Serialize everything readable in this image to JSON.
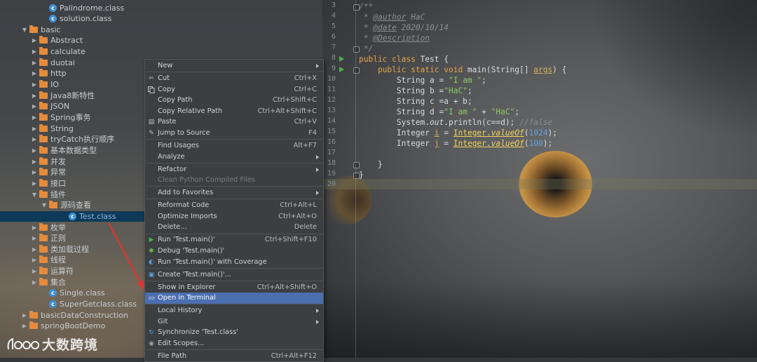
{
  "tree": [
    {
      "label": "Palindrome.class",
      "type": "class",
      "indent": 70,
      "arrow": ""
    },
    {
      "label": "solution.class",
      "type": "class",
      "indent": 70,
      "arrow": ""
    },
    {
      "label": "basic",
      "type": "folder",
      "indent": 56,
      "arrow": "open"
    },
    {
      "label": "Abstract",
      "type": "folder",
      "indent": 70,
      "arrow": "closed"
    },
    {
      "label": "calculate",
      "type": "folder",
      "indent": 70,
      "arrow": "closed"
    },
    {
      "label": "duotai",
      "type": "folder",
      "indent": 70,
      "arrow": "closed"
    },
    {
      "label": "http",
      "type": "folder",
      "indent": 70,
      "arrow": "closed"
    },
    {
      "label": "IO",
      "type": "folder",
      "indent": 70,
      "arrow": "closed"
    },
    {
      "label": "Java8新特性",
      "type": "folder",
      "indent": 70,
      "arrow": "closed"
    },
    {
      "label": "JSON",
      "type": "folder",
      "indent": 70,
      "arrow": "closed"
    },
    {
      "label": "Spring事务",
      "type": "folder",
      "indent": 70,
      "arrow": "closed"
    },
    {
      "label": "String",
      "type": "folder",
      "indent": 70,
      "arrow": "closed"
    },
    {
      "label": "tryCatch执行顺序",
      "type": "folder",
      "indent": 70,
      "arrow": "closed"
    },
    {
      "label": "基本数据类型",
      "type": "folder",
      "indent": 70,
      "arrow": "closed"
    },
    {
      "label": "并发",
      "type": "folder",
      "indent": 70,
      "arrow": "closed"
    },
    {
      "label": "异常",
      "type": "folder",
      "indent": 70,
      "arrow": "closed"
    },
    {
      "label": "接口",
      "type": "folder",
      "indent": 70,
      "arrow": "closed"
    },
    {
      "label": "插件",
      "type": "folder",
      "indent": 70,
      "arrow": "open"
    },
    {
      "label": "源码查看",
      "type": "folder",
      "indent": 84,
      "arrow": "open"
    },
    {
      "label": "Test.class",
      "type": "class",
      "indent": 98,
      "arrow": "",
      "selected": true
    },
    {
      "label": "枚举",
      "type": "folder",
      "indent": 70,
      "arrow": "closed"
    },
    {
      "label": "正则",
      "type": "folder",
      "indent": 70,
      "arrow": "closed"
    },
    {
      "label": "类加载过程",
      "type": "folder",
      "indent": 70,
      "arrow": "closed"
    },
    {
      "label": "线程",
      "type": "folder",
      "indent": 70,
      "arrow": "closed"
    },
    {
      "label": "运算符",
      "type": "folder",
      "indent": 70,
      "arrow": "closed"
    },
    {
      "label": "集合",
      "type": "folder",
      "indent": 70,
      "arrow": "closed"
    },
    {
      "label": "Single.class",
      "type": "class",
      "indent": 70,
      "arrow": ""
    },
    {
      "label": "SuperGetclass.class",
      "type": "class",
      "indent": 70,
      "arrow": ""
    },
    {
      "label": "basicDataConstruction",
      "type": "folder",
      "indent": 56,
      "arrow": "closed"
    },
    {
      "label": "springBootDemo",
      "type": "folder",
      "indent": 56,
      "arrow": "closed"
    }
  ],
  "gutter": [
    "3",
    "4",
    "5",
    "6",
    "7",
    "8",
    "9",
    "10",
    "11",
    "12",
    "13",
    "14",
    "15",
    "16",
    "17",
    "18",
    "19",
    "20"
  ],
  "code": [
    {
      "parts": [
        {
          "t": "/**",
          "c": "cm"
        }
      ]
    },
    {
      "parts": [
        {
          "t": " * ",
          "c": "cm"
        },
        {
          "t": "@author",
          "c": "tag"
        },
        {
          "t": " HaC",
          "c": "cm"
        }
      ]
    },
    {
      "parts": [
        {
          "t": " * ",
          "c": "cm"
        },
        {
          "t": "@date",
          "c": "tag"
        },
        {
          "t": " 2020/10/14",
          "c": "cm"
        }
      ]
    },
    {
      "parts": [
        {
          "t": " * ",
          "c": "cm"
        },
        {
          "t": "@Description",
          "c": "tag"
        }
      ]
    },
    {
      "parts": [
        {
          "t": " */",
          "c": "cm"
        }
      ]
    },
    {
      "parts": [
        {
          "t": "public class ",
          "c": "kw"
        },
        {
          "t": "Test {",
          "c": ""
        }
      ]
    },
    {
      "parts": [
        {
          "t": "    public static void ",
          "c": "kw"
        },
        {
          "t": "main(String[] ",
          "c": ""
        },
        {
          "t": "args",
          "c": "param"
        },
        {
          "t": ") {",
          "c": ""
        }
      ]
    },
    {
      "parts": [
        {
          "t": "        String a = ",
          "c": ""
        },
        {
          "t": "\"I am \"",
          "c": "str"
        },
        {
          "t": ";",
          "c": ""
        }
      ]
    },
    {
      "parts": [
        {
          "t": "        String b =",
          "c": ""
        },
        {
          "t": "\"HaC\"",
          "c": "str"
        },
        {
          "t": ";",
          "c": ""
        }
      ]
    },
    {
      "parts": [
        {
          "t": "        String c =a + b;",
          "c": ""
        }
      ]
    },
    {
      "parts": [
        {
          "t": "        String d =",
          "c": ""
        },
        {
          "t": "\"I am \"",
          "c": "str"
        },
        {
          "t": " + ",
          "c": ""
        },
        {
          "t": "\"HaC\"",
          "c": "str"
        },
        {
          "t": ";",
          "c": ""
        }
      ]
    },
    {
      "parts": [
        {
          "t": "        System.",
          "c": ""
        },
        {
          "t": "out",
          "c": "fn-i"
        },
        {
          "t": ".println(c==d); ",
          "c": ""
        },
        {
          "t": "//false",
          "c": "cm"
        }
      ]
    },
    {
      "parts": [
        {
          "t": "        Integer ",
          "c": ""
        },
        {
          "t": "i",
          "c": "param"
        },
        {
          "t": " = ",
          "c": ""
        },
        {
          "t": "Integer.",
          "c": "cls-ref"
        },
        {
          "t": "valueOf",
          "c": "cls-ref fn-i"
        },
        {
          "t": "(",
          "c": ""
        },
        {
          "t": "1024",
          "c": "num"
        },
        {
          "t": ");",
          "c": ""
        }
      ]
    },
    {
      "parts": [
        {
          "t": "        Integer ",
          "c": ""
        },
        {
          "t": "j",
          "c": "param"
        },
        {
          "t": " = ",
          "c": ""
        },
        {
          "t": "Integer.",
          "c": "cls-ref"
        },
        {
          "t": "valueOf",
          "c": "cls-ref fn-i"
        },
        {
          "t": "(",
          "c": ""
        },
        {
          "t": "100",
          "c": "num"
        },
        {
          "t": ");",
          "c": ""
        }
      ]
    },
    {
      "parts": [
        {
          "t": "",
          "c": ""
        }
      ]
    },
    {
      "parts": [
        {
          "t": "    }",
          "c": ""
        }
      ]
    },
    {
      "parts": [
        {
          "t": "}",
          "c": ""
        }
      ]
    },
    {
      "parts": [
        {
          "t": "",
          "c": ""
        }
      ]
    }
  ],
  "menu": [
    {
      "label": "New",
      "shortcut": "",
      "submenu": true,
      "icon": ""
    },
    {
      "sep": true
    },
    {
      "label": "Cut",
      "shortcut": "Ctrl+X",
      "icon": "scissors-icon",
      "glyph": "✂"
    },
    {
      "label": "Copy",
      "shortcut": "Ctrl+C",
      "icon": "copy-icon",
      "glyph": ""
    },
    {
      "label": "Copy Path",
      "shortcut": "Ctrl+Shift+C",
      "icon": ""
    },
    {
      "label": "Copy Relative Path",
      "shortcut": "Ctrl+Alt+Shift+C",
      "icon": ""
    },
    {
      "label": "Paste",
      "shortcut": "Ctrl+V",
      "icon": "paste-icon",
      "glyph": "▤"
    },
    {
      "label": "Jump to Source",
      "shortcut": "F4",
      "icon": "pencil-icon",
      "glyph": "✎"
    },
    {
      "sep": true
    },
    {
      "label": "Find Usages",
      "shortcut": "Alt+F7",
      "icon": ""
    },
    {
      "label": "Analyze",
      "shortcut": "",
      "submenu": true,
      "icon": ""
    },
    {
      "sep": true
    },
    {
      "label": "Refactor",
      "shortcut": "",
      "submenu": true,
      "icon": ""
    },
    {
      "label": "Clean Python Compiled Files",
      "shortcut": "",
      "disabled": true,
      "icon": ""
    },
    {
      "sep": true
    },
    {
      "label": "Add to Favorites",
      "shortcut": "",
      "submenu": true,
      "icon": ""
    },
    {
      "sep": true
    },
    {
      "label": "Reformat Code",
      "shortcut": "Ctrl+Alt+L",
      "icon": ""
    },
    {
      "label": "Optimize Imports",
      "shortcut": "Ctrl+Alt+O",
      "icon": ""
    },
    {
      "label": "Delete...",
      "shortcut": "Delete",
      "icon": ""
    },
    {
      "sep": true
    },
    {
      "label": "Run 'Test.main()'",
      "shortcut": "Ctrl+Shift+F10",
      "icon": "run-icon",
      "glyph": "▶"
    },
    {
      "label": "Debug 'Test.main()'",
      "shortcut": "",
      "icon": "debug-icon",
      "glyph": "✱"
    },
    {
      "label": "Run 'Test.main()' with Coverage",
      "shortcut": "",
      "icon": "coverage-icon",
      "glyph": "◐"
    },
    {
      "sep": true
    },
    {
      "label": "Create 'Test.main()'...",
      "shortcut": "",
      "icon": "config-icon",
      "glyph": "▣"
    },
    {
      "sep": true
    },
    {
      "label": "Show in Explorer",
      "shortcut": "Ctrl+Alt+Shift+O",
      "icon": ""
    },
    {
      "label": "Open in Terminal",
      "shortcut": "",
      "highlight": true,
      "icon": "terminal-icon",
      "glyph": "▭"
    },
    {
      "sep": true
    },
    {
      "label": "Local History",
      "shortcut": "",
      "submenu": true,
      "icon": ""
    },
    {
      "label": "Git",
      "shortcut": "",
      "submenu": true,
      "icon": ""
    },
    {
      "label": "Synchronize 'Test.class'",
      "shortcut": "",
      "icon": "sync-icon",
      "glyph": "↻"
    },
    {
      "label": "Edit Scopes...",
      "shortcut": "",
      "icon": "scopes-icon",
      "glyph": "◉"
    },
    {
      "sep": true
    },
    {
      "label": "File Path",
      "shortcut": "Ctrl+Alt+F12",
      "icon": ""
    }
  ],
  "watermark": {
    "text": "大数跨境",
    "logo_text": "DOO"
  },
  "colors": {
    "menu_highlight": "#4b6eaf",
    "selection": "#0d3a58",
    "annotation_arrow": "#e0342c",
    "folder": "#e58b3c",
    "class_icon": "#3d8fd6"
  }
}
